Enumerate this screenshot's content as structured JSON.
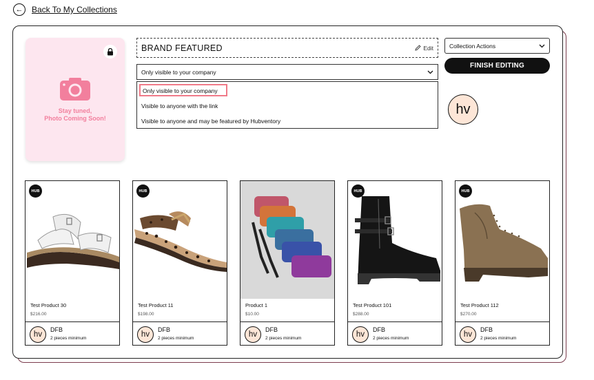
{
  "nav": {
    "back_label": "Back To My Collections"
  },
  "hero": {
    "message": "Stay tuned,\nPhoto Coming Soon!"
  },
  "collection": {
    "title": "BRAND FEATURED",
    "edit_label": "Edit"
  },
  "visibility": {
    "selected": "Only visible to your company",
    "options": [
      "Only visible to your company",
      "Visible to anyone with the link",
      "Visible to anyone and may be featured by Hubventory"
    ]
  },
  "actions": {
    "collection_actions_label": "Collection Actions",
    "finish_label": "FINISH EDITING"
  },
  "owner": {
    "avatar_text": "hv"
  },
  "colors": {
    "accent": "#f07a88",
    "hero_bg": "#fde6ef",
    "hero_text": "#f27f9d",
    "avatar_bg": "#fde6d7"
  },
  "products": [
    {
      "badge": "HUB",
      "name": "Test Product 30",
      "price": "$216.00",
      "avatar": "hv",
      "brand": "DFB",
      "minimum": "2 pieces minimum"
    },
    {
      "badge": "HUB",
      "name": "Test Product 11",
      "price": "$198.00",
      "avatar": "hv",
      "brand": "DFB",
      "minimum": "2 pieces minimum"
    },
    {
      "badge": "",
      "name": "Product 1",
      "price": "$10.00",
      "avatar": "hv",
      "brand": "DFB",
      "minimum": "2 pieces minimum"
    },
    {
      "badge": "HUB",
      "name": "Test Product 101",
      "price": "$288.00",
      "avatar": "hv",
      "brand": "DFB",
      "minimum": "2 pieces minimum"
    },
    {
      "badge": "HUB",
      "name": "Test Product 112",
      "price": "$270.00",
      "avatar": "hv",
      "brand": "DFB",
      "minimum": "2 pieces minimum"
    }
  ]
}
